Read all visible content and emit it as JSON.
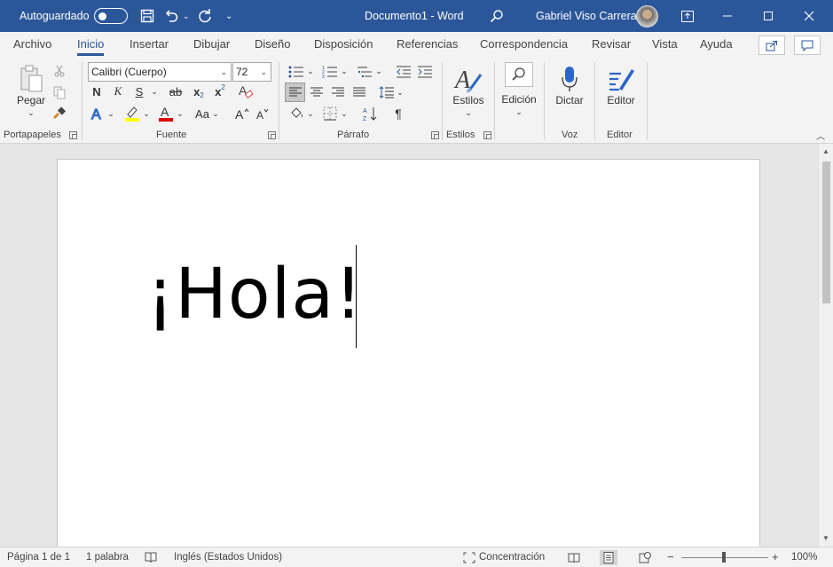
{
  "titlebar": {
    "autosave_label": "Autoguardado",
    "document_title": "Documento1 - Word",
    "user_name": "Gabriel Viso Carrera",
    "undo_dropdown": "⌄",
    "customize": "⌄"
  },
  "tabs": [
    {
      "label": "Archivo"
    },
    {
      "label": "Inicio"
    },
    {
      "label": "Insertar"
    },
    {
      "label": "Dibujar"
    },
    {
      "label": "Diseño"
    },
    {
      "label": "Disposición"
    },
    {
      "label": "Referencias"
    },
    {
      "label": "Correspondencia"
    },
    {
      "label": "Revisar"
    },
    {
      "label": "Vista"
    },
    {
      "label": "Ayuda"
    }
  ],
  "ribbon": {
    "clipboard": {
      "group_label": "Portapapeles",
      "paste_label": "Pegar"
    },
    "font": {
      "group_label": "Fuente",
      "font_name": "Calibri (Cuerpo)",
      "font_size": "72",
      "bold": "N",
      "italic": "K",
      "underline": "S",
      "strike": "ab",
      "change_case": "Aa"
    },
    "paragraph": {
      "group_label": "Párrafo",
      "pilcrow": "¶"
    },
    "styles": {
      "group_label": "Estilos",
      "button_label": "Estilos"
    },
    "editing": {
      "button_label": "Edición"
    },
    "voice": {
      "group_label": "Voz",
      "button_label": "Dictar"
    },
    "editor": {
      "group_label": "Editor",
      "button_label": "Editor"
    }
  },
  "document": {
    "text": "¡Hola!"
  },
  "statusbar": {
    "page": "Página 1 de 1",
    "words": "1 palabra",
    "language": "Inglés (Estados Unidos)",
    "focus": "Concentración",
    "zoom": "100%"
  },
  "colors": {
    "accent": "#2b579a",
    "highlight": "#ffff00",
    "font_color": "#e00000",
    "text_effects": "#2b66c8"
  },
  "icons": [
    "save-icon",
    "undo-icon",
    "redo-icon",
    "search-icon",
    "ribbon-display-icon",
    "minimize-icon",
    "maximize-icon",
    "close-icon",
    "share-icon",
    "comments-icon",
    "paste-icon",
    "cut-icon",
    "copy-icon",
    "format-painter-icon",
    "clear-formatting-icon",
    "text-effects-icon",
    "highlight-icon",
    "font-color-icon",
    "bullets-icon",
    "numbering-icon",
    "multilevel-list-icon",
    "decrease-indent-icon",
    "increase-indent-icon",
    "align-left-icon",
    "align-center-icon",
    "align-right-icon",
    "justify-icon",
    "line-spacing-icon",
    "shading-icon",
    "borders-icon",
    "sort-icon",
    "pilcrow-icon",
    "styles-icon",
    "find-icon",
    "microphone-icon",
    "editor-icon",
    "proofing-icon",
    "read-mode-icon",
    "print-layout-icon",
    "web-layout-icon"
  ]
}
